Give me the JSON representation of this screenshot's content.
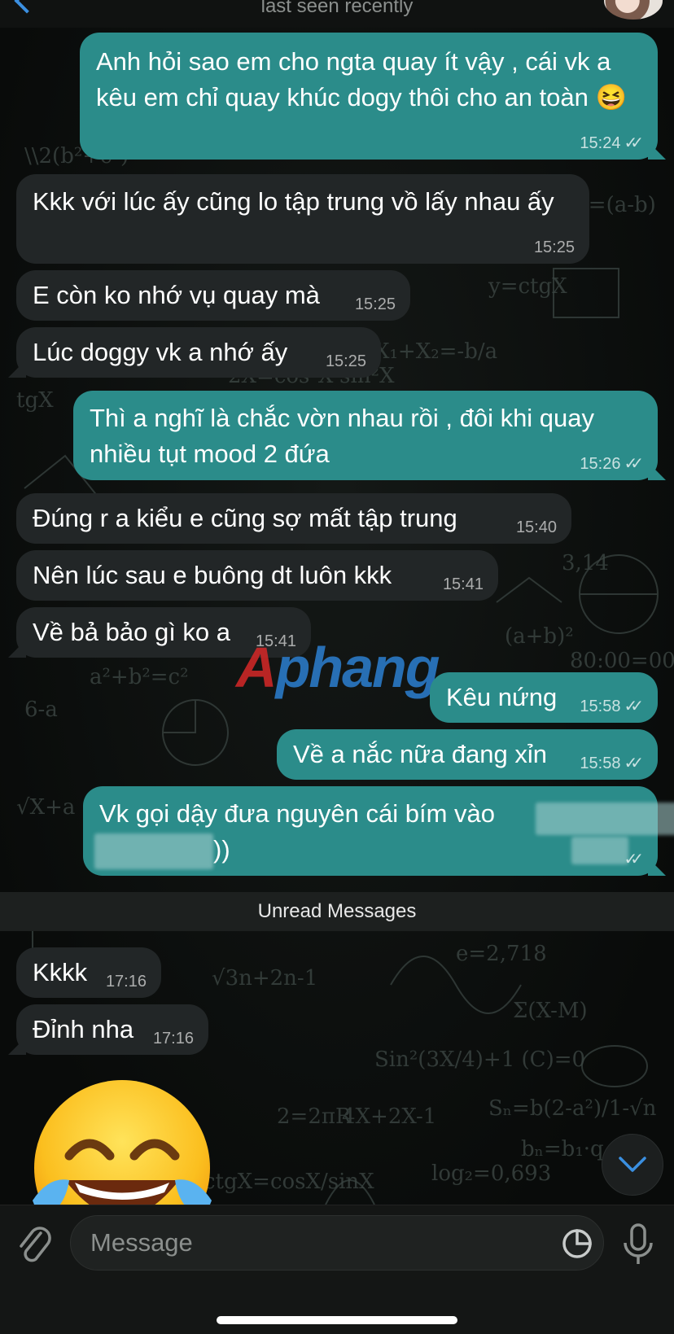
{
  "header": {
    "status": "last seen recently"
  },
  "messages": [
    {
      "id": "m1",
      "dir": "out",
      "text": "Anh hỏi sao em cho ngta quay ít vậy , cái vk a kêu em chỉ quay khúc dogy thôi cho an toàn 😆",
      "time": "15:24",
      "read": true
    },
    {
      "id": "m2",
      "dir": "in",
      "text": "Kkk với lúc ấy cũng lo tập trung vồ lấy nhau ấy",
      "time": "15:25"
    },
    {
      "id": "m3",
      "dir": "in",
      "text": "E còn ko nhớ vụ quay mà",
      "time": "15:25"
    },
    {
      "id": "m4",
      "dir": "in",
      "text": "Lúc doggy vk a nhớ ấy",
      "time": "15:25"
    },
    {
      "id": "m5",
      "dir": "out",
      "text": "Thì a nghĩ là chắc vờn nhau rồi , đôi khi quay nhiều tụt mood 2 đứa",
      "time": "15:26",
      "read": true
    },
    {
      "id": "m6",
      "dir": "in",
      "text": "Đúng r a kiểu e cũng sợ mất tập trung",
      "time": "15:40"
    },
    {
      "id": "m7",
      "dir": "in",
      "text": "Nên lúc sau e buông dt luôn kkk",
      "time": "15:41"
    },
    {
      "id": "m8",
      "dir": "in",
      "text": "Về bả bảo gì ko a",
      "time": "15:41"
    },
    {
      "id": "m9",
      "dir": "out",
      "text": "Kêu nứng",
      "time": "15:58",
      "read": true
    },
    {
      "id": "m10",
      "dir": "out",
      "text": "Về a nắc nữa đang xỉn",
      "time": "15:58",
      "read": true
    },
    {
      "id": "m11",
      "dir": "out",
      "text": "Vk gọi dậy đưa nguyên cái bím vào",
      "text2": "))",
      "time": "",
      "read": true
    },
    {
      "id": "m12",
      "dir": "in",
      "text": "Kkkk",
      "time": "17:16"
    },
    {
      "id": "m13",
      "dir": "in",
      "text": "Đỉnh nha",
      "time": "17:16"
    }
  ],
  "divider": "Unread Messages",
  "watermark": {
    "part1": "A",
    "part2": "phang"
  },
  "sticker": {
    "icon": "tears-of-joy-emoji"
  },
  "input": {
    "placeholder": "Message",
    "icons": [
      "paperclip-icon",
      "sticker-icon",
      "microphone-icon"
    ]
  },
  "colors": {
    "outgoing": "#2b8c8a",
    "incoming": "#222627",
    "accent": "#3b8fe0"
  }
}
